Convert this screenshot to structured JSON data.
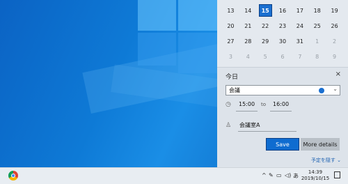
{
  "calendar": {
    "rows": [
      [
        {
          "d": "13"
        },
        {
          "d": "14"
        },
        {
          "d": "15",
          "sel": true
        },
        {
          "d": "16"
        },
        {
          "d": "17"
        },
        {
          "d": "18"
        },
        {
          "d": "19"
        }
      ],
      [
        {
          "d": "20"
        },
        {
          "d": "21"
        },
        {
          "d": "22"
        },
        {
          "d": "23"
        },
        {
          "d": "24"
        },
        {
          "d": "25"
        },
        {
          "d": "26"
        }
      ],
      [
        {
          "d": "27"
        },
        {
          "d": "28"
        },
        {
          "d": "29"
        },
        {
          "d": "30"
        },
        {
          "d": "31"
        },
        {
          "d": "1",
          "dim": true
        },
        {
          "d": "2",
          "dim": true
        }
      ],
      [
        {
          "d": "3",
          "dim": true
        },
        {
          "d": "4",
          "dim": true
        },
        {
          "d": "5",
          "dim": true
        },
        {
          "d": "6",
          "dim": true
        },
        {
          "d": "7",
          "dim": true
        },
        {
          "d": "8",
          "dim": true
        },
        {
          "d": "9",
          "dim": true
        }
      ]
    ]
  },
  "agenda": {
    "title": "今日",
    "close_icon": "×",
    "event_name": "会議",
    "calendar_color": "#1a6fd0",
    "start_time": "15:00",
    "to_label": "to",
    "end_time": "16:00",
    "location": "会議室A",
    "save_label": "Save",
    "more_label": "More details",
    "hide_label": "予定を隠す ⌄"
  },
  "taskbar": {
    "tray_chevron": "^",
    "ime": "あ",
    "time": "14:39",
    "date": "2019/10/15"
  }
}
